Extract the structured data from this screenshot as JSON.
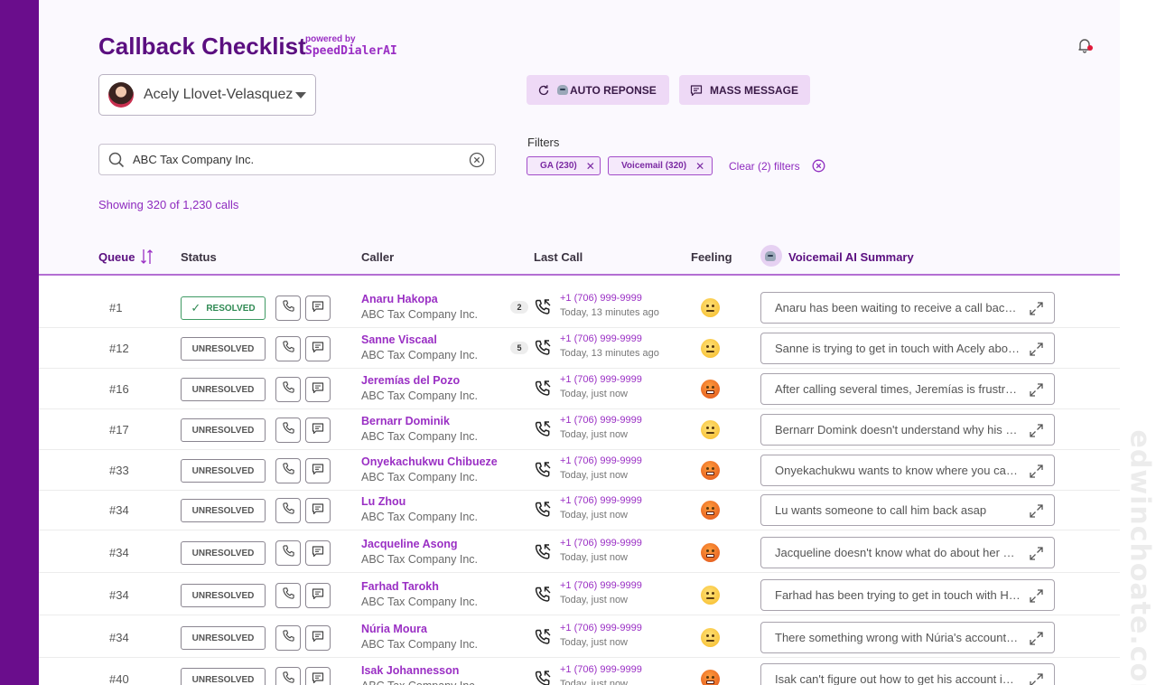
{
  "header": {
    "title": "Callback Checklist",
    "powered_by": "powered by",
    "brand": "SpeedDialerAI"
  },
  "agent": {
    "name": "Acely Llovet-Velasquez"
  },
  "actions": {
    "auto_response": "AUTO REPONSE",
    "mass_message": "MASS MESSAGE"
  },
  "search": {
    "value": "ABC Tax Company Inc."
  },
  "filters": {
    "label": "Filters",
    "chips": [
      "GA (230)",
      "Voicemail (320)"
    ],
    "clear": "Clear (2) filters"
  },
  "showing": "Showing 320 of 1,230 calls",
  "columns": {
    "queue": "Queue",
    "status": "Status",
    "caller": "Caller",
    "last_call": "Last Call",
    "feeling": "Feeling",
    "vm_summary": "Voicemail AI Summary"
  },
  "rows": [
    {
      "queue": "#1",
      "status": "RESOLVED",
      "name": "Anaru Hakopa",
      "company": "ABC Tax Company Inc.",
      "count": "2",
      "phone": "+1 (706) 999-9999",
      "when": "Today, 13 minutes ago",
      "feeling": "neutral",
      "summary": "Anaru has been waiting to receive a call back from Acely"
    },
    {
      "queue": "#12",
      "status": "UNRESOLVED",
      "name": "Sanne Viscaal",
      "company": "ABC Tax Company Inc.",
      "count": "5",
      "phone": "+1 (706) 999-9999",
      "when": "Today, 13 minutes ago",
      "feeling": "neutral",
      "summary": "Sanne is trying to get in touch with Acely about her return"
    },
    {
      "queue": "#16",
      "status": "UNRESOLVED",
      "name": "Jeremías del Pozo",
      "company": "ABC Tax Company Inc.",
      "count": "",
      "phone": "+1 (706) 999-9999",
      "when": "Today, just now",
      "feeling": "angry",
      "summary": "After calling several times, Jeremías is frustrated"
    },
    {
      "queue": "#17",
      "status": "UNRESOLVED",
      "name": "Bernarr Dominik",
      "company": "ABC Tax Company Inc.",
      "count": "",
      "phone": "+1 (706) 999-9999",
      "when": "Today, just now",
      "feeling": "neutral",
      "summary": "Bernarr Domink doesn't understand why his refund is late"
    },
    {
      "queue": "#33",
      "status": "UNRESOLVED",
      "name": "Onyekachukwu Chibueze",
      "company": "ABC Tax Company Inc.",
      "count": "",
      "phone": "+1 (706) 999-9999",
      "when": "Today, just now",
      "feeling": "angry",
      "summary": "Onyekachukwu wants to know where you can help him"
    },
    {
      "queue": "#34",
      "status": "UNRESOLVED",
      "name": "Lu Zhou",
      "company": "ABC Tax Company Inc.",
      "count": "",
      "phone": "+1 (706) 999-9999",
      "when": "Today, just now",
      "feeling": "angry",
      "summary": "Lu wants someone to call him back asap"
    },
    {
      "queue": "#34",
      "status": "UNRESOLVED",
      "name": "Jacqueline Asong",
      "company": "ABC Tax Company Inc.",
      "count": "",
      "phone": "+1 (706) 999-9999",
      "when": "Today, just now",
      "feeling": "angry",
      "summary": "Jacqueline doesn't know what do about her paperwork"
    },
    {
      "queue": "#34",
      "status": "UNRESOLVED",
      "name": "Farhad Tarokh",
      "company": "ABC Tax Company Inc.",
      "count": "",
      "phone": "+1 (706) 999-9999",
      "when": "Today, just now",
      "feeling": "neutral",
      "summary": "Farhad has been trying to get in touch with Hannah"
    },
    {
      "queue": "#34",
      "status": "UNRESOLVED",
      "name": "Núria Moura",
      "company": "ABC Tax Company Inc.",
      "count": "",
      "phone": "+1 (706) 999-9999",
      "when": "Today, just now",
      "feeling": "neutral",
      "summary": "There something wrong with Núria's account balance"
    },
    {
      "queue": "#40",
      "status": "UNRESOLVED",
      "name": "Isak Johannesson",
      "company": "ABC Tax Company Inc.",
      "count": "",
      "phone": "+1 (706) 999-9999",
      "when": "Today, just now",
      "feeling": "angry",
      "summary": "Isak can't figure out how to get his account information"
    }
  ],
  "watermark": "edwinchoate.com",
  "colors": {
    "brand": "#6a0d8c",
    "accent": "#9a2fc4",
    "resolved": "#3f9a63"
  }
}
